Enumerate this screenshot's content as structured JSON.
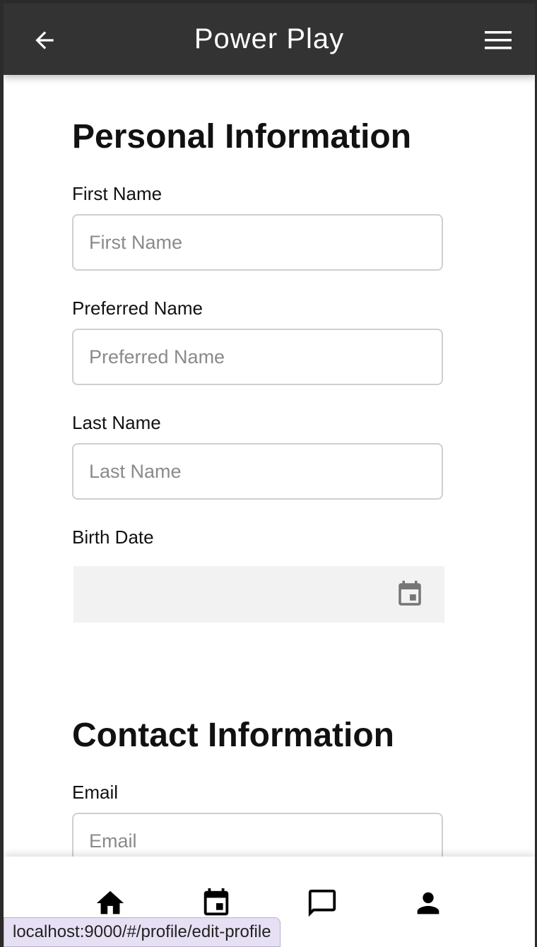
{
  "app_bar": {
    "title": "Power Play",
    "back_icon": "arrow-left-icon",
    "menu_icon": "hamburger-menu-icon"
  },
  "personal": {
    "title": "Personal Information",
    "first_name": {
      "label": "First Name",
      "placeholder": "First Name",
      "value": ""
    },
    "preferred_name": {
      "label": "Preferred Name",
      "placeholder": "Preferred Name",
      "value": ""
    },
    "last_name": {
      "label": "Last Name",
      "placeholder": "Last Name",
      "value": ""
    },
    "birth_date": {
      "label": "Birth Date",
      "value": "",
      "icon": "calendar-icon"
    }
  },
  "contact": {
    "title": "Contact Information",
    "email": {
      "label": "Email",
      "placeholder": "Email",
      "value": ""
    }
  },
  "bottom_nav": {
    "items": [
      {
        "icon": "home-icon"
      },
      {
        "icon": "calendar-event-icon"
      },
      {
        "icon": "chat-icon"
      },
      {
        "icon": "person-icon"
      }
    ]
  },
  "status_bar": {
    "url": "localhost:9000/#/profile/edit-profile"
  },
  "colors": {
    "app_bar": "#333333",
    "input_border": "#cfcfcf",
    "date_field_bg": "#f2f2f2",
    "status_bg": "#e7e0f5"
  }
}
